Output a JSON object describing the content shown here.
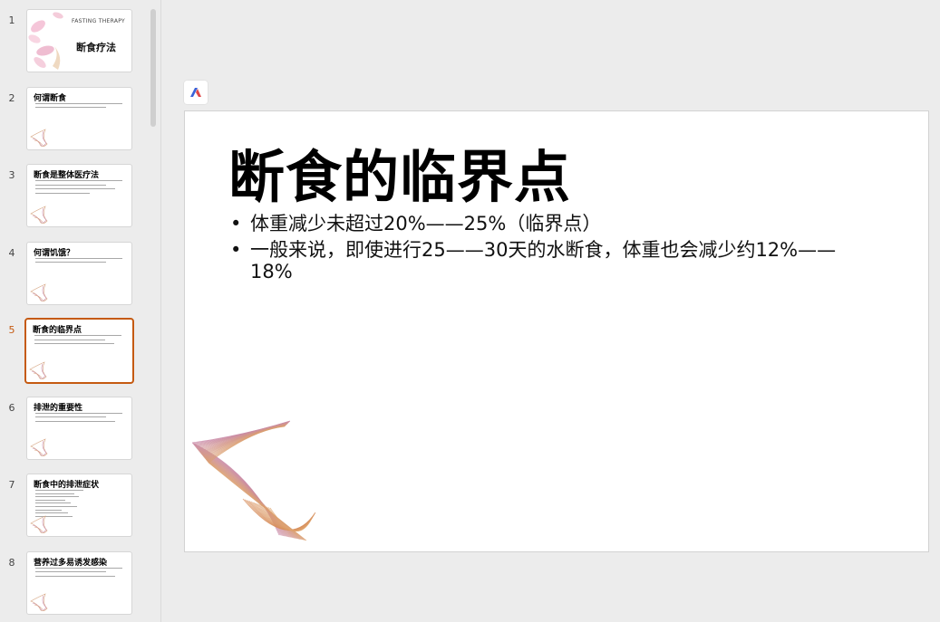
{
  "thumbnails": [
    {
      "number": "1",
      "type": "cover",
      "en": "FASTING THERAPY",
      "title": "断食疗法"
    },
    {
      "number": "2",
      "type": "content",
      "title": "何谓断食",
      "lines": 2
    },
    {
      "number": "3",
      "type": "content",
      "title": "断食是整体医疗法",
      "lines": 4
    },
    {
      "number": "4",
      "type": "content",
      "title": "何谓饥饿？",
      "lines": 2
    },
    {
      "number": "5",
      "type": "content",
      "title": "断食的临界点",
      "lines": 3,
      "active": true
    },
    {
      "number": "6",
      "type": "content",
      "title": "排泄的重要性",
      "lines": 3
    },
    {
      "number": "7",
      "type": "content",
      "title": "断食中的排泄症状",
      "lines": 9
    },
    {
      "number": "8",
      "type": "content",
      "title": "营养过多易诱发感染",
      "lines": 3
    }
  ],
  "slide": {
    "title": "断食的临界点",
    "bullets": [
      "体重减少未超过20%——25%（临界点）",
      "一般来说，即使进行25——30天的水断食，体重也会减少约12%——18%"
    ]
  },
  "colors": {
    "active_border": "#c55a11",
    "logo_blue": "#3b63d9",
    "logo_red": "#e04848",
    "deco_pink": "#c98aa8",
    "deco_orange": "#dba070"
  },
  "icons": {
    "logo": "app-logo-icon"
  }
}
